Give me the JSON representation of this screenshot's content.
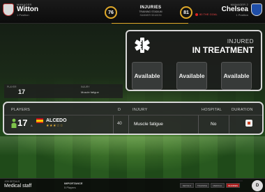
{
  "header": {
    "home_manager_label": "MANAGER",
    "home_team": "Witton",
    "home_sub": "1 Position",
    "home_rating": "76",
    "away_manager_label": "MANAGER 2",
    "away_team": "Chelsea",
    "away_sub": "1 Position",
    "away_rating": "81",
    "center_title": "INJURIES",
    "center_line2": "TRAINING STADIUM",
    "center_line3": "SUMMER SEASON",
    "goal_text": "80 THE GOAL"
  },
  "injured_panel": {
    "label": "INJURED",
    "status": "IN TREATMENT",
    "slots": [
      "Available",
      "Available",
      "Available"
    ]
  },
  "faint_row": {
    "col_player": "PLAYER",
    "col_injury": "INJURY",
    "number": "17",
    "injury": "Muscle fatigue"
  },
  "row": {
    "headers": {
      "players": "PLAYERS",
      "days": "D",
      "injury": "INJURY",
      "hospital": "HOSPITAL",
      "duration": "DURATION"
    },
    "player_number": "17",
    "position": "A",
    "player_name": "ALCEDO",
    "stars": "★★★☆☆",
    "days": "40",
    "injury": "Muscle fatigue",
    "hospital": "No"
  },
  "bottom": {
    "small_label": "JOB DETAILS",
    "title": "Medical staff",
    "importance_label": "IMPORTANCE",
    "importance_value": "5 Players",
    "tabs": [
      "DETAILS",
      "TRAINING",
      "MEDICAL",
      "INJURIES"
    ],
    "active_tab": "INJURIES",
    "button": "D"
  },
  "colors": {
    "accent": "#e0a92a",
    "panel_border": "#d7d7d7",
    "red": "#a91b1b"
  }
}
